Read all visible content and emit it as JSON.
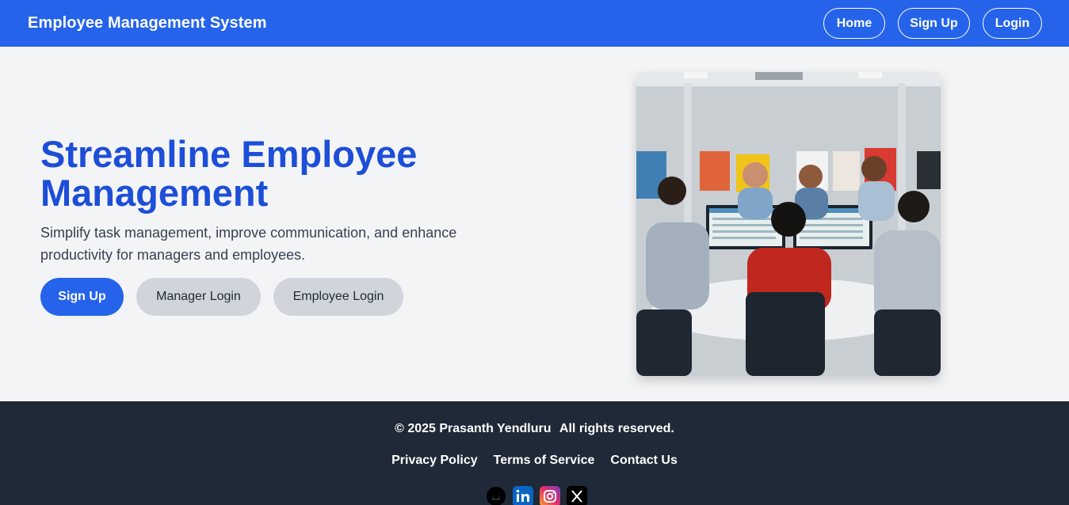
{
  "header": {
    "brand": "Employee Management System",
    "nav": {
      "home": "Home",
      "signup": "Sign Up",
      "login": "Login"
    }
  },
  "hero": {
    "title": "Streamline Employee Management",
    "subtitle": "Simplify task management, improve communication, and enhance productivity for managers and employees.",
    "buttons": {
      "signup": "Sign Up",
      "manager_login": "Manager Login",
      "employee_login": "Employee Login"
    },
    "image": "team-meeting-illustration"
  },
  "footer": {
    "copyright": "© 2025 Prasanth Yendluru",
    "rights": "All rights reserved.",
    "links": {
      "privacy": "Privacy Policy",
      "terms": "Terms of Service",
      "contact": "Contact Us"
    },
    "socials": [
      "github-icon",
      "linkedin-icon",
      "instagram-icon",
      "x-icon"
    ]
  },
  "colors": {
    "primary": "#2563eb",
    "heading": "#1d4ed8",
    "footer_bg": "#1f2937",
    "page_bg": "#f3f4f6",
    "secondary_button": "#d1d5db"
  }
}
